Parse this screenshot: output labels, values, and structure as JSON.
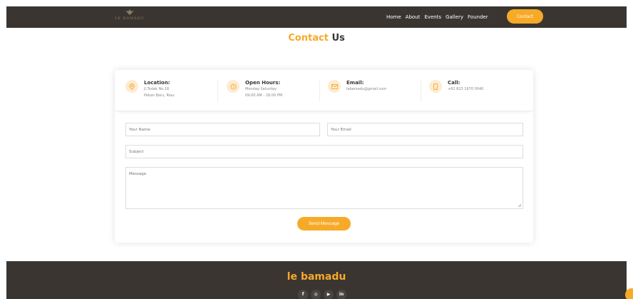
{
  "header": {
    "logo_text": "LE BAMADU",
    "nav": [
      "Home",
      "About",
      "Events",
      "Gallery",
      "Founder"
    ],
    "cta": "Contact"
  },
  "title": {
    "accent": "Contact",
    "rest": "Us"
  },
  "info": [
    {
      "title": "Location:",
      "lines": [
        "Jl.Todak No.18",
        "Pekan Baru, Riau"
      ],
      "icon": "location-pin-icon"
    },
    {
      "title": "Open Hours:",
      "lines": [
        "Monday-Saturday",
        "09:00 AM - 18:00 PM"
      ],
      "icon": "clock-icon"
    },
    {
      "title": "Email:",
      "lines": [
        "lebamadu@gmail.com"
      ],
      "icon": "envelope-icon"
    },
    {
      "title": "Call:",
      "lines": [
        "+62 823 1670 0040"
      ],
      "icon": "phone-icon"
    }
  ],
  "form": {
    "name_placeholder": "Your Name",
    "email_placeholder": "Your Email",
    "subject_placeholder": "Subject",
    "message_placeholder": "Message",
    "send_label": "Send Message"
  },
  "footer": {
    "brand": "le bamadu",
    "socials": [
      {
        "label": "f",
        "icon": "facebook-icon"
      },
      {
        "label": "◎",
        "icon": "instagram-icon"
      },
      {
        "label": "▶",
        "icon": "youtube-icon"
      },
      {
        "label": "in",
        "icon": "linkedin-icon"
      }
    ]
  },
  "colors": {
    "accent": "#f7a928",
    "dark": "#3a3530",
    "icon_bg": "#fdecd2"
  }
}
